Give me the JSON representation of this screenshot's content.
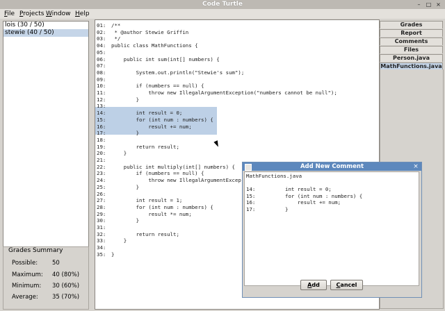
{
  "window": {
    "title": "Code Turtle"
  },
  "menu": [
    "File",
    "Projects",
    "Window",
    "Help"
  ],
  "projects": [
    {
      "label": "lois (30 / 50)",
      "selected": false
    },
    {
      "label": "stewie (40 / 50)",
      "selected": true
    }
  ],
  "summary": {
    "title": "Grades Summary",
    "rows": [
      {
        "label": "Possible:",
        "value": "50"
      },
      {
        "label": "Maximum:",
        "value": "40 (80%)"
      },
      {
        "label": "Minimum:",
        "value": "30 (60%)"
      },
      {
        "label": "Average:",
        "value": "35 (70%)"
      }
    ]
  },
  "tabs": [
    {
      "label": "Grades",
      "active": false
    },
    {
      "label": "Report",
      "active": false
    },
    {
      "label": "Comments",
      "active": false
    },
    {
      "label": "Files",
      "active": false
    },
    {
      "label": "Person.java",
      "active": false
    },
    {
      "label": "MathFunctions.java",
      "active": true
    }
  ],
  "code": [
    {
      "n": "01:",
      "t": "/**"
    },
    {
      "n": "02:",
      "t": " * @author Stewie Griffin"
    },
    {
      "n": "03:",
      "t": " */"
    },
    {
      "n": "04:",
      "t": "public class MathFunctions {"
    },
    {
      "n": "05:",
      "t": ""
    },
    {
      "n": "06:",
      "t": "    public int sum(int[] numbers) {"
    },
    {
      "n": "07:",
      "t": ""
    },
    {
      "n": "08:",
      "t": "        System.out.println(\"Stewie's sum\");"
    },
    {
      "n": "09:",
      "t": ""
    },
    {
      "n": "10:",
      "t": "        if (numbers == null) {"
    },
    {
      "n": "11:",
      "t": "            throw new IllegalArgumentException(\"numbers cannot be null\");"
    },
    {
      "n": "12:",
      "t": "        }"
    },
    {
      "n": "13:",
      "t": ""
    },
    {
      "n": "14:",
      "t": "        int result = 0;"
    },
    {
      "n": "15:",
      "t": "        for (int num : numbers) {"
    },
    {
      "n": "16:",
      "t": "            result += num;"
    },
    {
      "n": "17:",
      "t": "        }"
    },
    {
      "n": "18:",
      "t": ""
    },
    {
      "n": "19:",
      "t": "        return result;"
    },
    {
      "n": "20:",
      "t": "    }"
    },
    {
      "n": "21:",
      "t": ""
    },
    {
      "n": "22:",
      "t": "    public int multiply(int[] numbers) {"
    },
    {
      "n": "23:",
      "t": "        if (numbers == null) {"
    },
    {
      "n": "24:",
      "t": "            throw new IllegalArgumentExcep"
    },
    {
      "n": "25:",
      "t": "        }"
    },
    {
      "n": "26:",
      "t": ""
    },
    {
      "n": "27:",
      "t": "        int result = 1;"
    },
    {
      "n": "28:",
      "t": "        for (int num : numbers) {"
    },
    {
      "n": "29:",
      "t": "            result *= num;"
    },
    {
      "n": "30:",
      "t": "        }"
    },
    {
      "n": "31:",
      "t": ""
    },
    {
      "n": "32:",
      "t": "        return result;"
    },
    {
      "n": "33:",
      "t": "    }"
    },
    {
      "n": "34:",
      "t": ""
    },
    {
      "n": "35:",
      "t": "}"
    }
  ],
  "dialog": {
    "title": "Add New Comment",
    "file": "MathFunctions.java",
    "lines": [
      {
        "n": "14:",
        "t": "int result = 0;"
      },
      {
        "n": "15:",
        "t": "for (int num : numbers) {"
      },
      {
        "n": "16:",
        "t": "    result += num;"
      },
      {
        "n": "17:",
        "t": "}"
      }
    ],
    "add_label": "Add",
    "cancel_label": "Cancel"
  }
}
